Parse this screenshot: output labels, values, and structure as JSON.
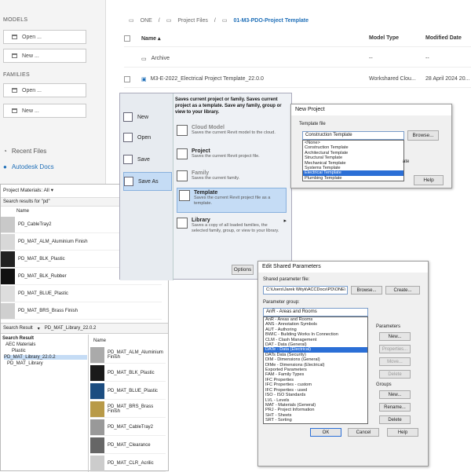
{
  "home": {
    "models_title": "MODELS",
    "families_title": "FAMILIES",
    "open_label": "Open ...",
    "new_label": "New ...",
    "recent_files": "Recent Files",
    "autodesk_docs": "Autodesk Docs"
  },
  "browser": {
    "crumbs": [
      "ONE",
      "Project Files",
      "01-M3-PDO-Project Template"
    ],
    "col_name": "Name",
    "col_model_type": "Model Type",
    "col_modified": "Modified Date",
    "rows": [
      {
        "name": "Archive",
        "type": "--",
        "date": "--"
      },
      {
        "name": "M3-E-2022_Electrical Project Template_22.0.0",
        "type": "Workshared Clou...",
        "date": "28 April 2024 20..."
      }
    ]
  },
  "filemenu": {
    "items": [
      "New",
      "Open",
      "Save",
      "Save As"
    ],
    "tip": "Saves current project or family. Saves current project as a template. Save any family, group or view to your library.",
    "options": [
      {
        "title": "Cloud Model",
        "desc": "Saves the current Revit model to the cloud."
      },
      {
        "title": "Project",
        "desc": "Saves the current Revit project file."
      },
      {
        "title": "Family",
        "desc": "Saves the current family."
      },
      {
        "title": "Template",
        "desc": "Saves the current Revit project file as a template."
      },
      {
        "title": "Library",
        "desc": "Saves a copy of all loaded families, the selected family, group, or view to your library."
      }
    ],
    "options_btn": "Options"
  },
  "newproj": {
    "title": "New Project",
    "template_label": "Template file",
    "selected": "Construction Template",
    "browse": "Browse...",
    "list": [
      "<None>",
      "Construction Template",
      "Architectural Template",
      "Structural Template",
      "Mechanical Template",
      "Systems Template",
      "Electrical Template",
      "Plumbing Template"
    ],
    "hidden_label": "ate",
    "help": "Help"
  },
  "materials": {
    "header": "Project Materials: All",
    "search": "Search results for \"pd\"",
    "col_name": "Name",
    "project_items": [
      "PD_CableTray2",
      "PD_MAT_ALM_Aluminium Finish",
      "PD_MAT_BLK_Plastic",
      "PD_MAT_BLK_Rubber",
      "PD_MAT_BLUE_Plastic",
      "PD_MAT_BRS_Brass Finish"
    ],
    "lib_tab1": "Search Result",
    "lib_tab2": "PD_MAT_Library_22.0.2",
    "tree_root": "Search Result",
    "tree": [
      "AEC Materials",
      "Plastic",
      "PD_MAT_Library_22.0.2",
      "PD_MAT_Library"
    ],
    "lib_col_name": "Name",
    "lib_items": [
      "PD_MAT_ALM_Aluminium Finish",
      "PD_MAT_BLK_Plastic",
      "PD_MAT_BLUE_Plastic",
      "PD_MAT_BRS_Brass Finish",
      "PD_MAT_CableTray2",
      "PD_MAT_Clearance",
      "PD_MAT_CLR_Acrilic"
    ]
  },
  "esp": {
    "title": "Edit Shared Parameters",
    "file_label": "Shared parameter file:",
    "file_path": "C:\\Users\\Jarek Wityk\\ACCDocs\\PD\\ONE\\",
    "browse": "Browse...",
    "create": "Create...",
    "group_label": "Parameter group:",
    "group_selected": "AnR - Areas and Rooms",
    "groups": [
      "AnR - Areas and Rooms",
      "ANS - Annotation Symbols",
      "AUT - Authoring",
      "BWIC - Building Works In Connection",
      "CLM - Clash Management",
      "DAT - Data (General)",
      "DATe - Data (Electrical)",
      "DATs Data (Security)",
      "DIM - Dimensions (General)",
      "DIMe - Dimensions (Electrical)",
      "Exported Parameters",
      "FAM - Family Types",
      "IFC Properties",
      "IFC Properties - custom",
      "IFC Properties - used",
      "ISO - ISO Standards",
      "LVL - Levels",
      "MAT - Materials (General)",
      "PRJ - Project Information",
      "SHT - Sheets",
      "SRT - Sorting"
    ],
    "parameters_label": "Parameters",
    "p_new": "New...",
    "p_props": "Properties...",
    "p_move": "Move...",
    "p_delete": "Delete",
    "groups_label": "Groups",
    "g_new": "New...",
    "g_rename": "Rename...",
    "g_delete": "Delete",
    "ok": "OK",
    "cancel": "Cancel",
    "help": "Help"
  },
  "colors": {
    "accent": "#1f6fb8",
    "highlight": "#2b6fd6",
    "selected_bg": "#c5dcf5"
  }
}
